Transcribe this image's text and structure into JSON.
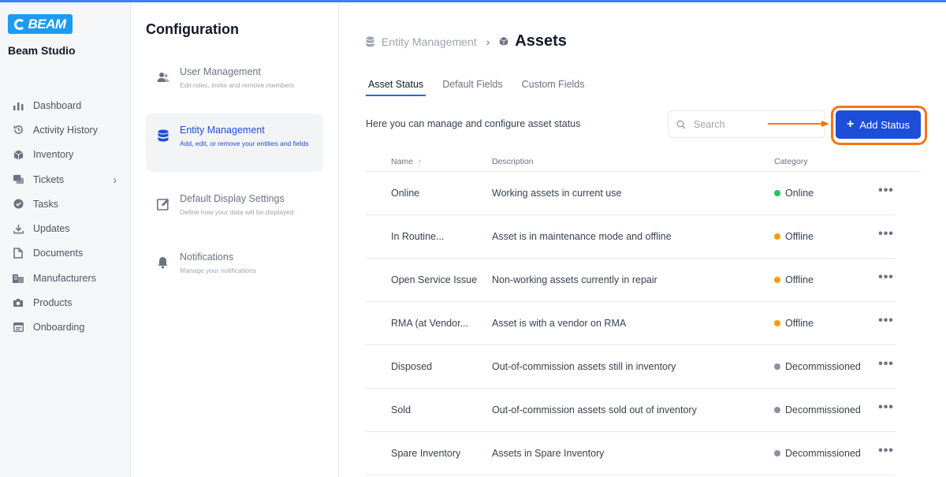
{
  "app": {
    "logo_text": "BEAM",
    "org_name": "Beam Studio"
  },
  "sidebar": {
    "items": [
      {
        "label": "Dashboard",
        "icon": "bar-chart-icon"
      },
      {
        "label": "Activity History",
        "icon": "history-icon"
      },
      {
        "label": "Inventory",
        "icon": "cube-icon"
      },
      {
        "label": "Tickets",
        "icon": "tickets-icon",
        "has_chevron": true
      },
      {
        "label": "Tasks",
        "icon": "check-circle-icon"
      },
      {
        "label": "Updates",
        "icon": "download-icon"
      },
      {
        "label": "Documents",
        "icon": "document-icon"
      },
      {
        "label": "Manufacturers",
        "icon": "building-icon"
      },
      {
        "label": "Products",
        "icon": "camera-icon"
      },
      {
        "label": "Onboarding",
        "icon": "onboarding-icon"
      }
    ],
    "chevron": "›"
  },
  "config": {
    "title": "Configuration",
    "items": [
      {
        "title": "User Management",
        "desc": "Edit roles, invite and remove members",
        "icon": "users-icon"
      },
      {
        "title": "Entity Management",
        "desc": "Add, edit, or remove your entities and fields",
        "icon": "database-icon",
        "active": true
      },
      {
        "title": "Default Display Settings",
        "desc": "Define how your data will be displayed",
        "icon": "edit-display-icon"
      },
      {
        "title": "Notifications",
        "desc": "Manage your notifications",
        "icon": "bell-icon"
      }
    ]
  },
  "breadcrumb": {
    "parent": "Entity Management",
    "separator": "›",
    "current": "Assets"
  },
  "tabs": [
    {
      "label": "Asset Status",
      "active": true
    },
    {
      "label": "Default Fields"
    },
    {
      "label": "Custom Fields"
    }
  ],
  "subtitle": "Here you can manage and configure asset status",
  "search": {
    "placeholder": "Search",
    "value": ""
  },
  "add_button": {
    "plus": "+",
    "label": "Add Status"
  },
  "table": {
    "columns": {
      "name": "Name",
      "name_sort": "↑",
      "description": "Description",
      "category": "Category"
    },
    "more_glyph": "•••",
    "rows": [
      {
        "name": "Online",
        "description": "Working assets in current use",
        "category": "Online",
        "color": "#22c55e"
      },
      {
        "name": "In Routine...",
        "description": "Asset is in maintenance mode and offline",
        "category": "Offline",
        "color": "#f59e0b"
      },
      {
        "name": "Open Service Issue",
        "description": "Non-working assets currently in repair",
        "category": "Offline",
        "color": "#f59e0b"
      },
      {
        "name": "RMA (at Vendor...",
        "description": "Asset is with a vendor on RMA",
        "category": "Offline",
        "color": "#f59e0b"
      },
      {
        "name": "Disposed",
        "description": "Out-of-commission assets still in inventory",
        "category": "Decommissioned",
        "color": "#8b8fa8"
      },
      {
        "name": "Sold",
        "description": "Out-of-commission assets sold out of inventory",
        "category": "Decommissioned",
        "color": "#8b8fa8"
      },
      {
        "name": "Spare Inventory",
        "description": "Assets in Spare Inventory",
        "category": "Decommissioned",
        "color": "#8b8fa8"
      }
    ]
  },
  "colors": {
    "accent": "#1d4ed8",
    "highlight": "#f97316",
    "online": "#22c55e",
    "offline": "#f59e0b",
    "decommissioned": "#8b8fa8"
  }
}
